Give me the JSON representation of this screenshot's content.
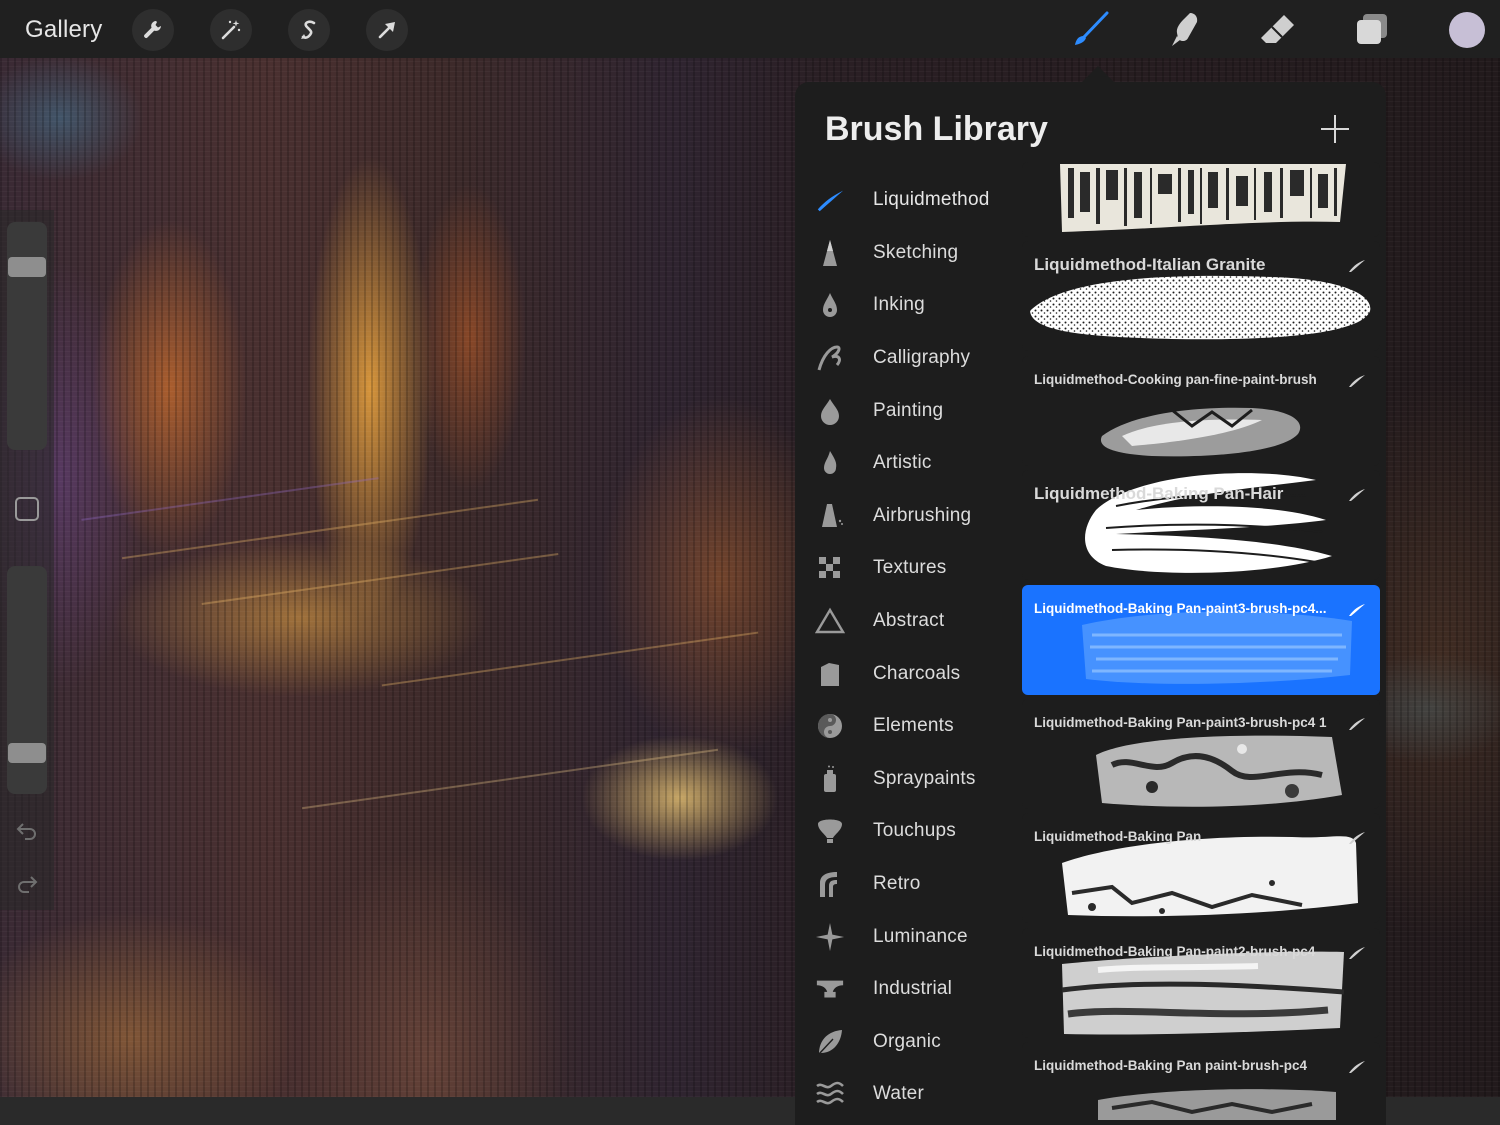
{
  "topbar": {
    "gallery_label": "Gallery",
    "tools_left": [
      "wrench-icon",
      "magic-wand-icon",
      "selection-icon",
      "transform-arrow-icon"
    ],
    "tools_right": [
      "brush-icon",
      "smudge-icon",
      "eraser-icon",
      "layers-icon"
    ],
    "active_tool": "brush-icon",
    "color_swatch": "#c7bfd6"
  },
  "sidebar": {
    "brush_size_level": 0.82,
    "opacity_level": 0.15
  },
  "panel": {
    "title": "Brush Library",
    "accent": "#1a73ff",
    "categories": [
      {
        "label": "Liquidmethod",
        "icon": "liquidmethod-stroke-icon",
        "active": true
      },
      {
        "label": "Sketching",
        "icon": "pencil-tip-icon"
      },
      {
        "label": "Inking",
        "icon": "ink-drop-icon"
      },
      {
        "label": "Calligraphy",
        "icon": "calligraphy-icon"
      },
      {
        "label": "Painting",
        "icon": "paint-drop-icon"
      },
      {
        "label": "Artistic",
        "icon": "flame-drop-icon"
      },
      {
        "label": "Airbrushing",
        "icon": "airbrush-icon"
      },
      {
        "label": "Textures",
        "icon": "checker-icon"
      },
      {
        "label": "Abstract",
        "icon": "triangle-icon"
      },
      {
        "label": "Charcoals",
        "icon": "charcoal-icon"
      },
      {
        "label": "Elements",
        "icon": "yin-yang-icon"
      },
      {
        "label": "Spraypaints",
        "icon": "spray-can-icon"
      },
      {
        "label": "Touchups",
        "icon": "touchup-icon"
      },
      {
        "label": "Retro",
        "icon": "retro-icon"
      },
      {
        "label": "Luminance",
        "icon": "sparkle-icon"
      },
      {
        "label": "Industrial",
        "icon": "anvil-icon"
      },
      {
        "label": "Organic",
        "icon": "leaf-icon"
      },
      {
        "label": "Water",
        "icon": "waves-icon"
      }
    ],
    "brushes": [
      {
        "name": ""
      },
      {
        "name": "Liquidmethod-Italian Granite"
      },
      {
        "name": "Liquidmethod-Cooking pan-fine-paint-brush"
      },
      {
        "name": "Liquidmethod-Baking Pan-Hair"
      },
      {
        "name": "Liquidmethod-Baking Pan-paint3-brush-pc4...",
        "selected": true
      },
      {
        "name": "Liquidmethod-Baking Pan-paint3-brush-pc4 1"
      },
      {
        "name": "Liquidmethod-Baking Pan"
      },
      {
        "name": "Liquidmethod-Baking Pan-paint2-brush-pc4"
      },
      {
        "name": "Liquidmethod-Baking Pan paint-brush-pc4"
      }
    ]
  }
}
